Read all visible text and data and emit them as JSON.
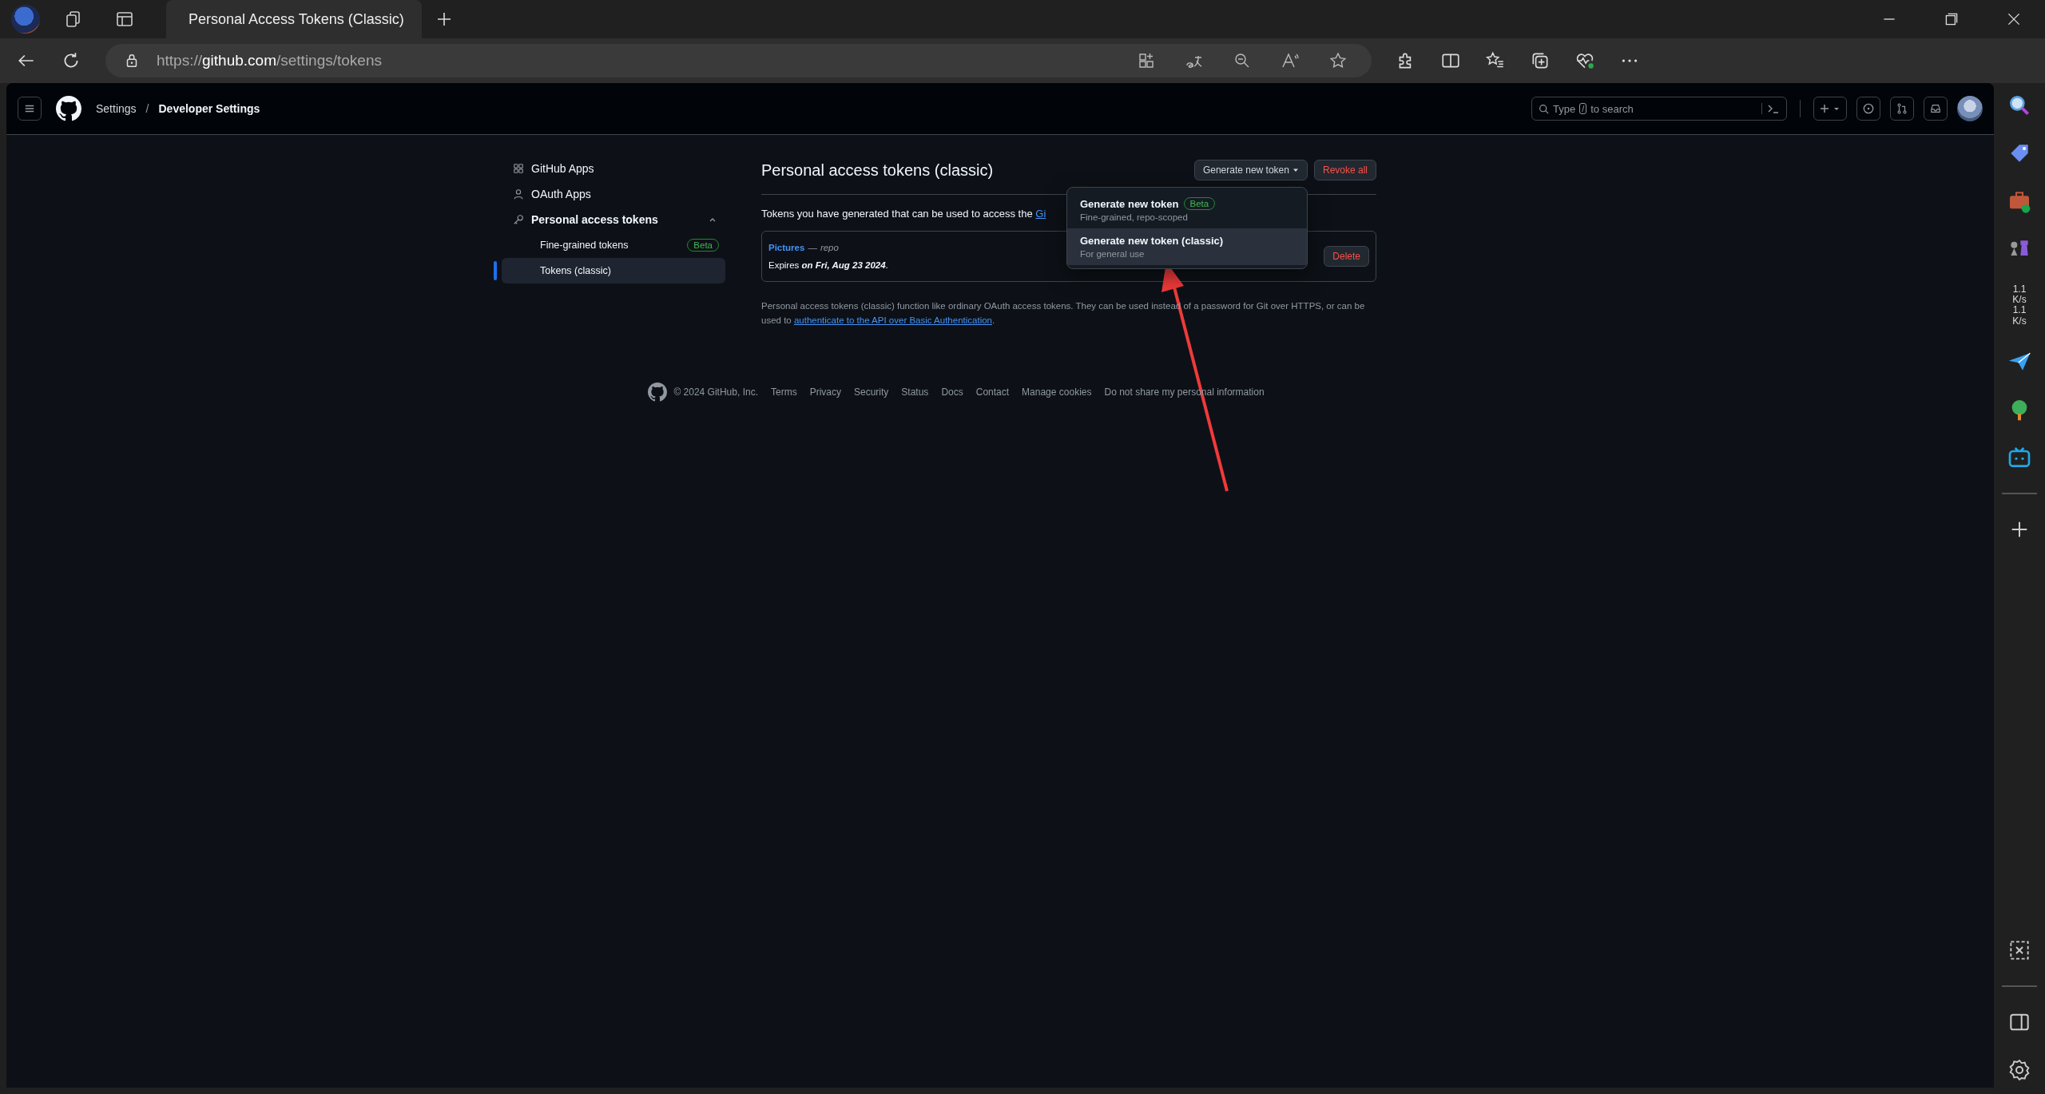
{
  "browser": {
    "tabs": [
      {
        "title": "Personal Access Tokens (Classic)",
        "selected": true
      }
    ],
    "url": {
      "scheme": "https://",
      "host": "github.com",
      "path": "/settings/tokens"
    }
  },
  "header": {
    "breadcrumbs": [
      {
        "label": "Settings",
        "current": false
      },
      {
        "separator": "/",
        "label": "Developer Settings",
        "current": true
      }
    ],
    "search": {
      "placeholder_before": "Type",
      "key": "/",
      "placeholder_after": "to search"
    }
  },
  "sidebar": {
    "items": [
      {
        "label": "GitHub Apps",
        "expanded": false
      },
      {
        "label": "OAuth Apps",
        "expanded": false
      },
      {
        "label": "Personal access tokens",
        "expanded": true,
        "children": [
          {
            "label": "Fine-grained tokens",
            "badge": "Beta",
            "selected": false
          },
          {
            "label": "Tokens (classic)",
            "selected": true
          }
        ]
      }
    ]
  },
  "main": {
    "title": "Personal access tokens (classic)",
    "generate_button": "Generate new token",
    "revoke_button": "Revoke all",
    "menu": [
      {
        "title": "Generate new token",
        "badge": "Beta",
        "subtitle": "Fine-grained, repo-scoped",
        "selected": false
      },
      {
        "title": "Generate new token (classic)",
        "subtitle": "For general use",
        "selected": true
      }
    ],
    "intro": "Tokens you have generated that can be used to access the ",
    "intro_link": "Gi",
    "token": {
      "name": "Pictures",
      "separator": "—",
      "scope": "repo",
      "expires": "Expires **on Fri, Aug 23 2024**.",
      "delete_button": "Delete"
    },
    "note": "Personal access tokens (classic) function like ordinary OAuth access tokens. They can be used instead of a password for Git over HTTPS, or can be used to ",
    "note_link": "authenticate to the API over Basic Authentication",
    "note_end": "."
  },
  "footer": {
    "copyright": "© 2024 GitHub, Inc.",
    "links": [
      "Terms",
      "Privacy",
      "Security",
      "Status",
      "Docs",
      "Contact",
      "Manage cookies",
      "Do not share my personal information"
    ]
  },
  "side_panel": {
    "speeds": [
      "1.1",
      "K/s",
      "1.1",
      "K/s"
    ]
  }
}
